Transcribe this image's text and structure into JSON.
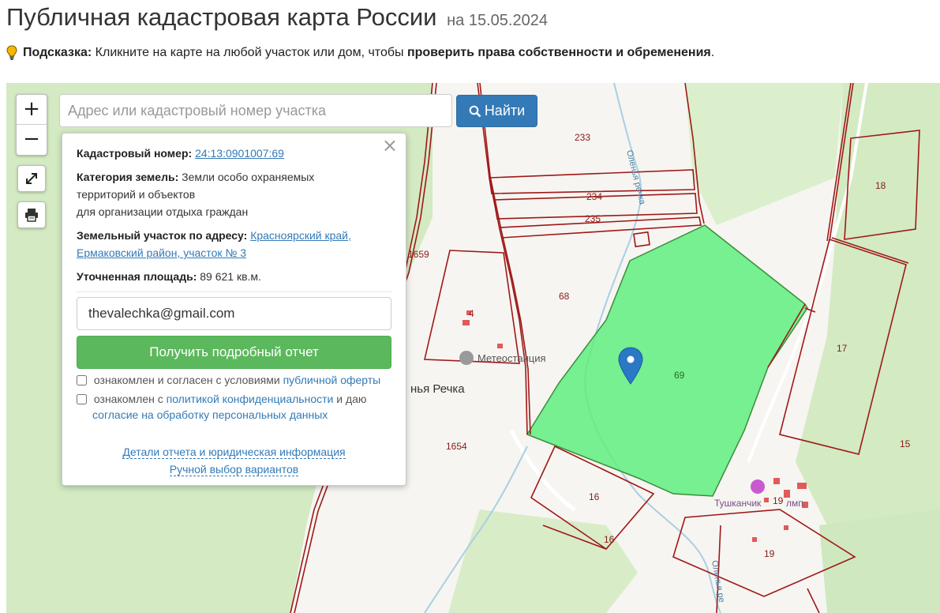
{
  "header": {
    "title": "Публичная кадастровая карта России",
    "date": "на 15.05.2024"
  },
  "hint": {
    "label": "Подсказка:",
    "text": "Кликните на карте на любой участок или дом, чтобы",
    "bold": "проверить права собственности и обременения",
    "end": "."
  },
  "search": {
    "placeholder": "Адрес или кадастровый номер участка",
    "button": "Найти"
  },
  "zoom": {
    "in": "+",
    "out": "−"
  },
  "popup": {
    "cadastral_label": "Кадастровый номер:",
    "cadastral_value": "24:13:0901007:69",
    "category_label": "Категория земель:",
    "category_line1": "Земли особо охраняемых",
    "category_line2": "территорий и объектов",
    "category_line3": "для организации отдыха граждан",
    "address_label": "Земельный участок по адресу:",
    "address_part1": "Красноярский край,",
    "address_part2": "Ермаковский район, участок № 3",
    "area_label": "Уточненная площадь:",
    "area_value": "89 621 кв.м.",
    "email_value": "thevalechka@gmail.com",
    "report_button": "Получить подробный отчет",
    "check1_text": "ознакомлен и согласен с условиями",
    "check1_link": "публичной оферты",
    "check2_text": "ознакомлен с",
    "check2_link1": "политикой конфиденциальности",
    "check2_mid": "и даю",
    "check2_link2": "согласие на обработку персональных данных",
    "details_link": "Детали отчета и юридическая информация",
    "manual_link": "Ручной выбор вариантов"
  },
  "map_labels": {
    "p233": "233",
    "p234": "234",
    "p235": "235",
    "p18": "18",
    "p1659": "1659",
    "p68": "68",
    "p4": "4",
    "p69": "69",
    "p17": "17",
    "p1654": "1654",
    "p15": "15",
    "p16a": "16",
    "p16b": "16",
    "p19a": "19",
    "p19b": "19",
    "meteo": "Метеостанция",
    "village": "нья Речка",
    "camp": "Тушканчик",
    "camp_suffix": "лмп.",
    "river_top": "Оленья речка",
    "river_bottom": "Оленья ре"
  },
  "colors": {
    "selected_parcel": "#5fee7f",
    "parcel_border": "#a01818",
    "forest": "#cfe8bf",
    "pin": "#2a78c6",
    "find_button": "#337ab7",
    "report_button": "#5cb85c"
  }
}
